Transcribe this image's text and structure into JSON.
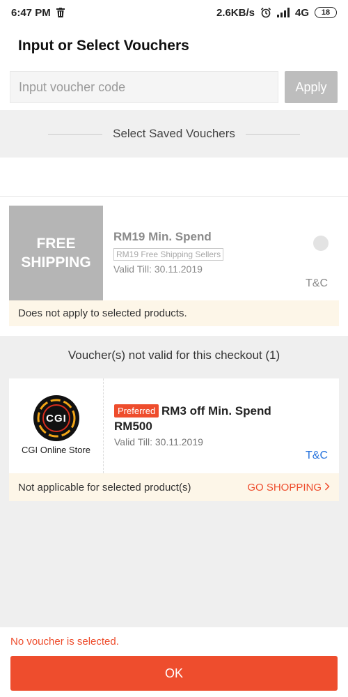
{
  "status_bar": {
    "time": "6:47 PM",
    "speed": "2.6KB/s",
    "network": "4G",
    "battery": "18"
  },
  "header": {
    "title": "Input or Select Vouchers"
  },
  "voucher_input": {
    "placeholder": "Input voucher code",
    "value": "",
    "apply_label": "Apply"
  },
  "saved_section": {
    "title": "Select Saved Vouchers"
  },
  "shipping_voucher": {
    "badge_line1": "FREE",
    "badge_line2": "SHIPPING",
    "min_spend": "RM19 Min. Spend",
    "tag": "RM19 Free Shipping Sellers",
    "valid_till": "Valid Till: 30.11.2019",
    "tc_label": "T&C",
    "notice": "Does not apply to selected products."
  },
  "invalid_section": {
    "heading": "Voucher(s) not valid for this checkout (1)",
    "store_card": {
      "store_name": "CGI Online Store",
      "logo_text": "CGI",
      "preferred_label": "Preferred",
      "offer": "RM3 off Min. Spend RM500",
      "valid_till": "Valid Till: 30.11.2019",
      "tc_label": "T&C",
      "notice": "Not applicable for selected product(s)",
      "go_shopping_label": "GO SHOPPING"
    }
  },
  "footer": {
    "warning": "No voucher is selected.",
    "ok_label": "OK"
  },
  "colors": {
    "accent": "#ee4d2d",
    "link_blue": "#2673dd",
    "disabled_grey": "#bdbdbd",
    "notice_bg": "#fdf6e8"
  }
}
